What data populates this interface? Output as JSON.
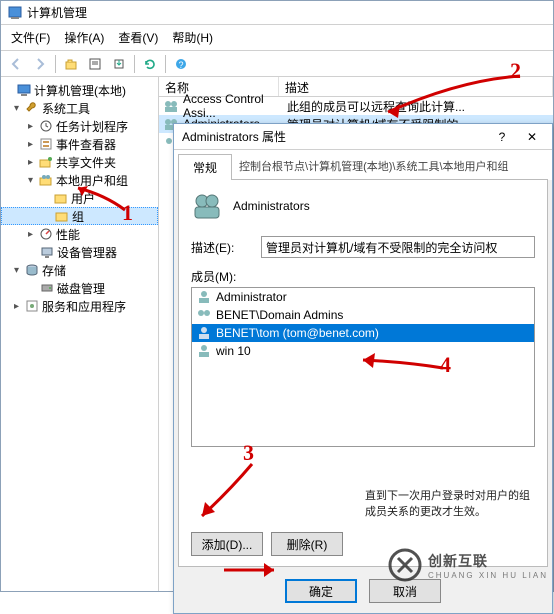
{
  "window": {
    "title": "计算机管理"
  },
  "menu": {
    "file": "文件(F)",
    "action": "操作(A)",
    "view": "查看(V)",
    "help": "帮助(H)"
  },
  "tree": {
    "root": "计算机管理(本地)",
    "system_tools": "系统工具",
    "task_scheduler": "任务计划程序",
    "event_viewer": "事件查看器",
    "shared_folders": "共享文件夹",
    "local_users_groups": "本地用户和组",
    "users": "用户",
    "groups": "组",
    "performance": "性能",
    "device_manager": "设备管理器",
    "storage": "存储",
    "disk_mgmt": "磁盘管理",
    "services_apps": "服务和应用程序"
  },
  "list": {
    "col_name": "名称",
    "col_desc": "描述",
    "rows": [
      {
        "name": "Access Control Assi...",
        "desc": "此组的成员可以远程查询此计算..."
      },
      {
        "name": "Administrators",
        "desc": "管理员对计算机/域有不受限制的..."
      }
    ]
  },
  "dialog": {
    "title": "Administrators 属性",
    "tab_general": "常规",
    "tab_info": "控制台根节点\\计算机管理(本地)\\系统工具\\本地用户和组",
    "group_name": "Administrators",
    "desc_label": "描述(E):",
    "desc_value": "管理员对计算机/域有不受限制的完全访问权",
    "members_label": "成员(M):",
    "members": [
      "Administrator",
      "BENET\\Domain Admins",
      "BENET\\tom (tom@benet.com)",
      "win 10"
    ],
    "hint": "直到下一次用户登录时对用户的组成员关系的更改才生效。",
    "add": "添加(D)...",
    "remove": "删除(R)",
    "ok": "确定",
    "cancel": "取消"
  },
  "annotations": {
    "n1": "1",
    "n2": "2",
    "n3": "3",
    "n4": "4"
  },
  "watermark": {
    "brand": "创新互联",
    "sub": "CHUANG XIN HU LIAN"
  }
}
